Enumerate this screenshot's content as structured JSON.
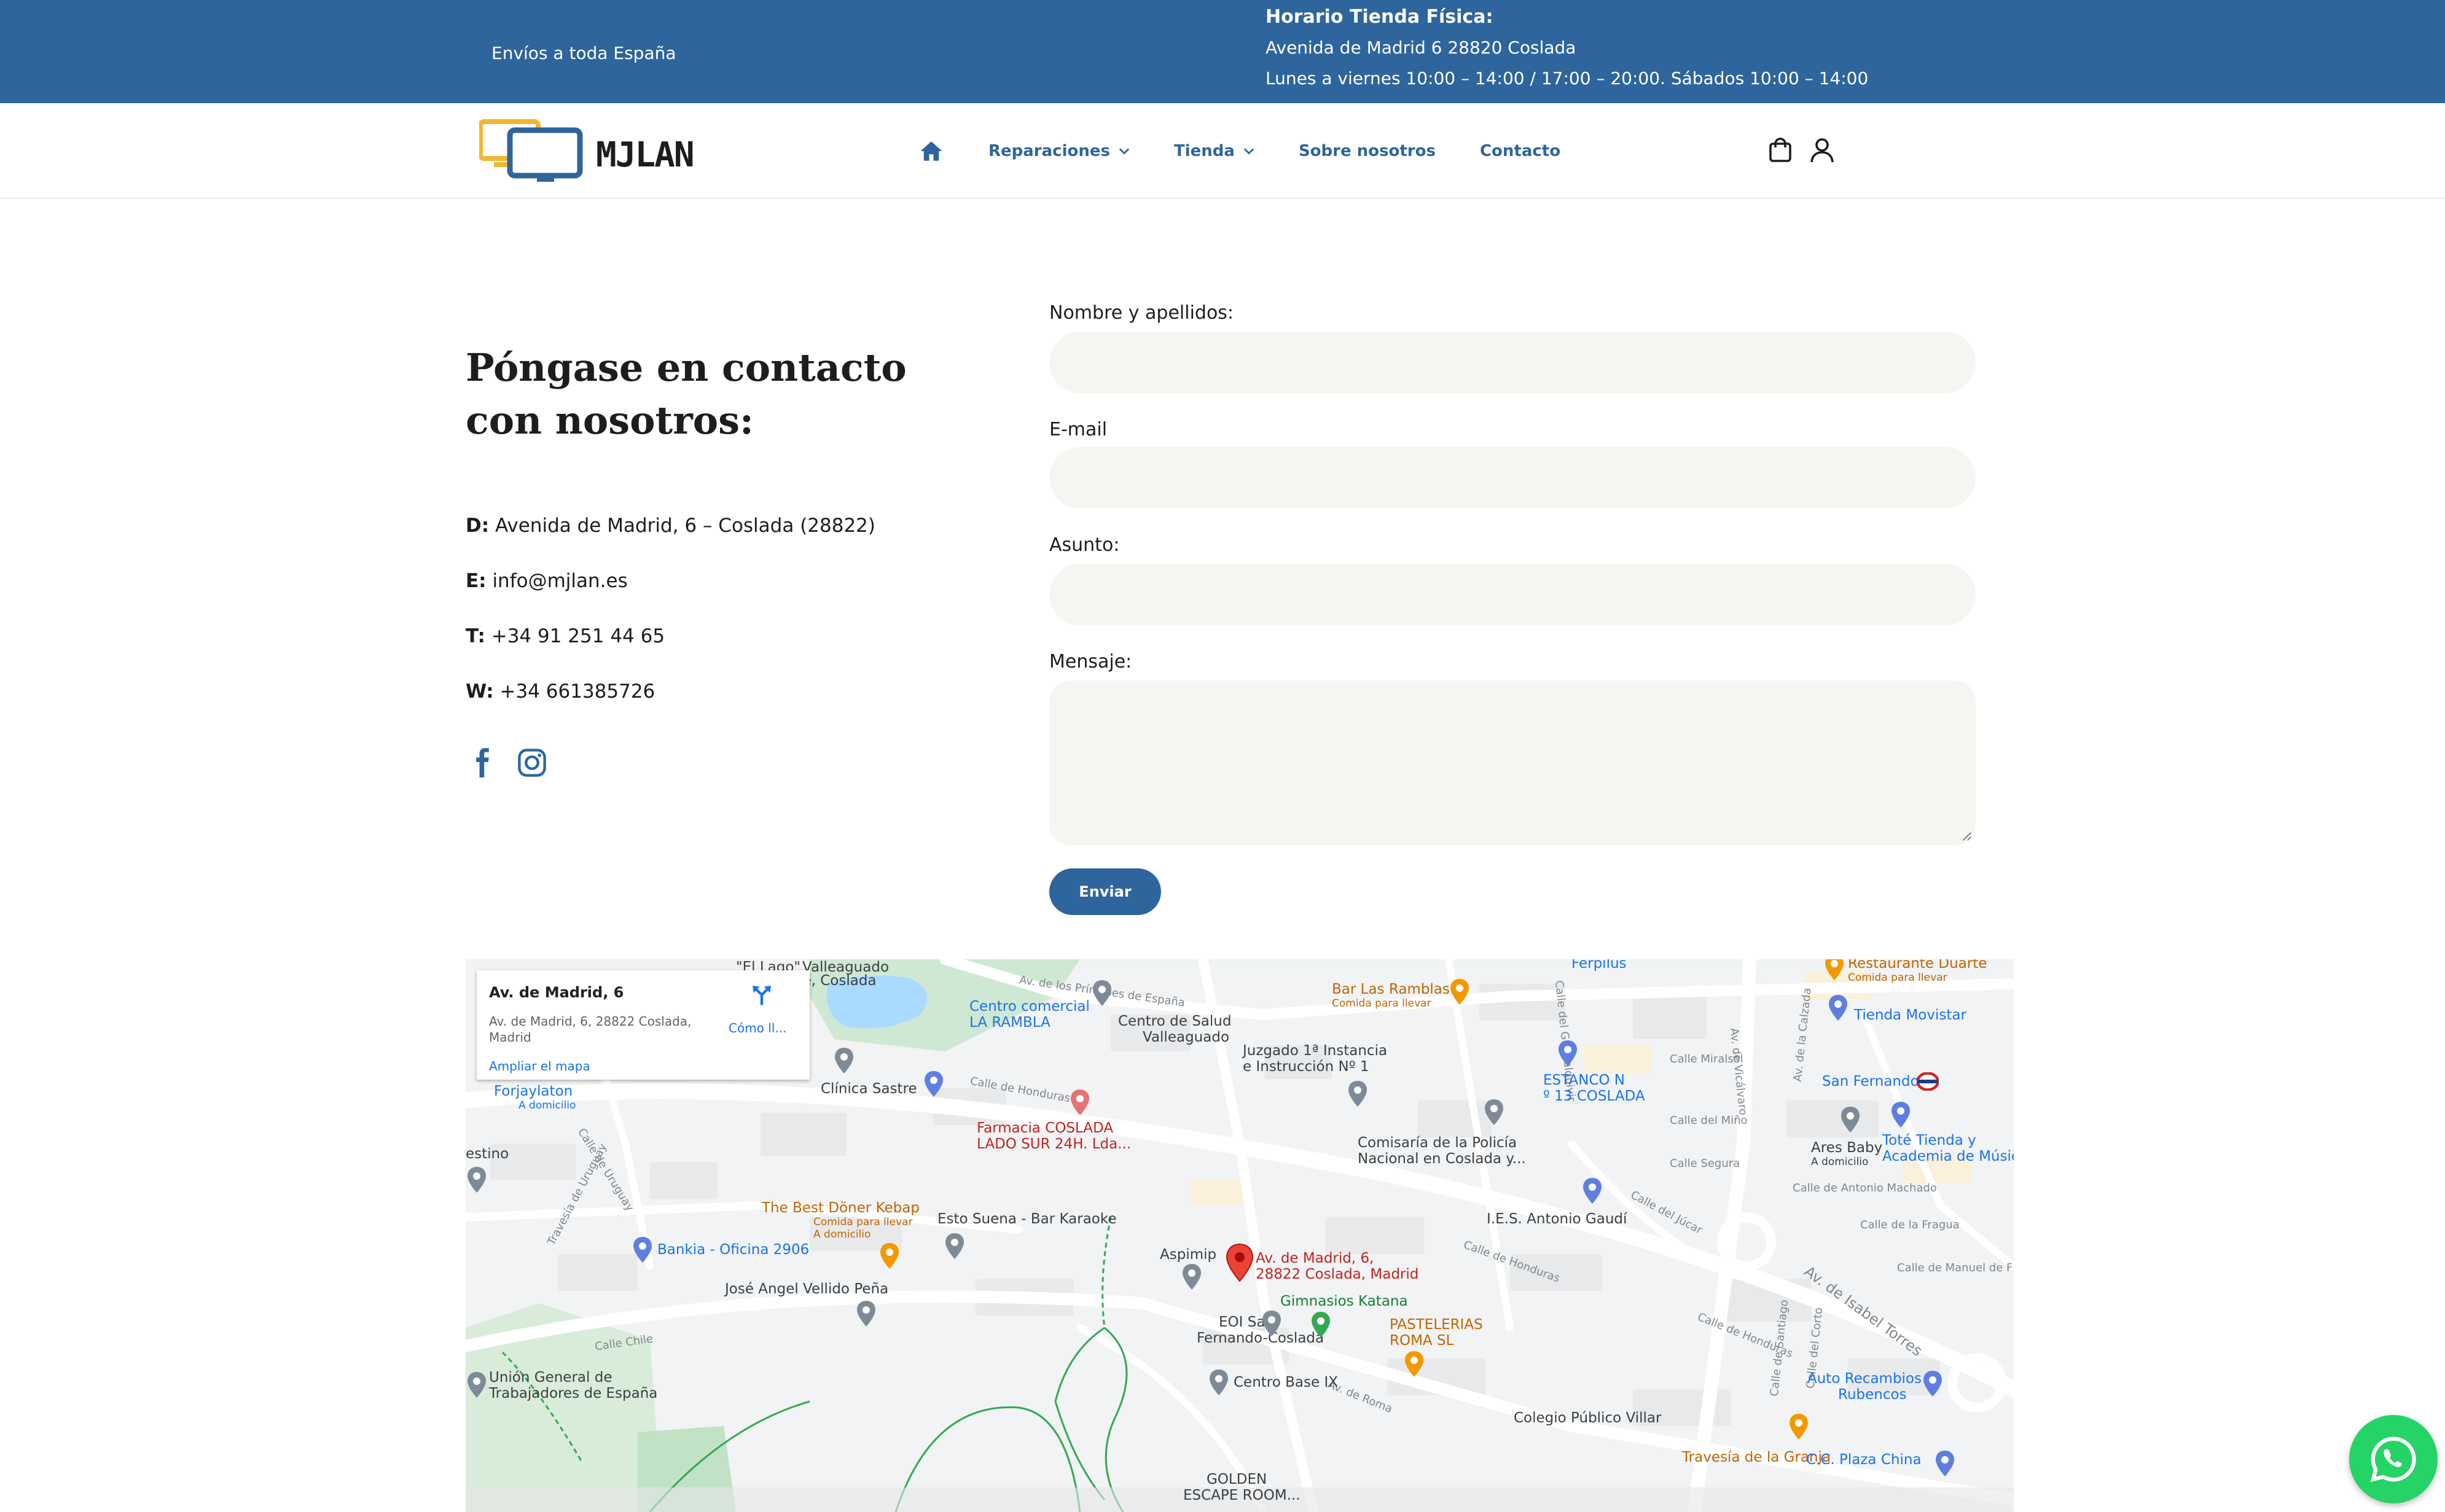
{
  "topbar": {
    "shipping": "Envíos a toda España",
    "hours_title": "Horario Tienda Física:",
    "hours_address": "Avenida de Madrid 6 28820 Coslada",
    "hours_schedule": "Lunes a viernes 10:00 – 14:00 / 17:00 – 20:00. Sábados 10:00 – 14:00"
  },
  "header": {
    "logo_text": "MJLAN",
    "nav": [
      {
        "label": "Reparaciones",
        "has_dropdown": true
      },
      {
        "label": "Tienda",
        "has_dropdown": true
      },
      {
        "label": "Sobre nosotros",
        "has_dropdown": false
      },
      {
        "label": "Contacto",
        "has_dropdown": false
      }
    ],
    "icons": [
      "home-icon",
      "cart-icon",
      "user-icon"
    ]
  },
  "contact": {
    "title": "Póngase en contacto con nosotros:",
    "items": [
      {
        "key": "D:",
        "value": "Avenida de Madrid, 6 – Coslada (28822)"
      },
      {
        "key": "E:",
        "value": "info@mjlan.es"
      },
      {
        "key": "T:",
        "value": "+34 91 251 44 65"
      },
      {
        "key": "W:",
        "value": "+34 661385726"
      }
    ],
    "social": [
      "facebook-icon",
      "instagram-icon"
    ]
  },
  "form": {
    "name_label": "Nombre y apellidos:",
    "name_value": "",
    "email_label": "E-mail",
    "email_value": "",
    "subject_label": "Asunto:",
    "subject_value": "",
    "message_label": "Mensaje:",
    "message_value": "",
    "submit_label": "Enviar"
  },
  "map": {
    "card_title": "Av. de Madrid, 6",
    "card_address": "Av. de Madrid, 6, 28822 Coslada, Madrid",
    "card_directions": "Cómo ll...",
    "card_enlarge": "Ampliar el mapa",
    "labels": {
      "el_lago": "\"El Lago\"",
      "valleaguado": "Valleaguado",
      "coslada": "rte, Coslada",
      "cc_rambla": "Centro comercial",
      "cc_rambla2": "LA RAMBLA",
      "centro_salud": "Centro de Salud",
      "centro_salud2": "Valleaguado",
      "bar_ramblas": "Bar Las Ramblas",
      "bar_ramblas_sub": "Comida para llevar",
      "restaurante": "Restaurante Duarte",
      "restaurante_sub": "Comida para llevar",
      "tienda_movistar": "Tienda Movistar",
      "juzgado": "Juzgado 1ª Instancia",
      "juzgado2": "e Instrucción Nº 1",
      "estanco": "ESTANCO N",
      "estanco2": "º 13 COSLADA",
      "san_fernando": "San Fernando",
      "forjaylaton": "Forjaylaton",
      "forjaylaton_sub": "A domicilio",
      "clinica": "Clínica Sastre",
      "farmacia": "Farmacia COSLADA",
      "farmacia2": "LADO SUR 24H. Lda...",
      "comisaria": "Comisaría de la Policía",
      "comisaria2": "Nacional en Coslada y...",
      "ares_baby": "Ares Baby",
      "ares_baby_sub": "A domicilio",
      "tote": "Toté Tienda y",
      "tote2": "Academia de Músic",
      "estino": "estino",
      "doner": "The Best Döner Kebap",
      "doner_sub": "Comida para llevar",
      "doner_sub2": "A domicilio",
      "esto_suena": "Esto Suena - Bar Karaoke",
      "ies": "I.E.S. Antonio Gaudí",
      "bankia": "Bankia - Oficina 2906",
      "aspimip": "Aspimip",
      "pin_addr": "Av. de Madrid, 6,",
      "pin_addr2": "28822 Coslada, Madrid",
      "gimnasios": "Gimnasios Katana",
      "vellido": "José Angel Vellido Peña",
      "eoi": "EOI San",
      "eoi2": "Fernando-Coslada",
      "pastelerias": "PASTELERIAS",
      "pastelerias2": "ROMA SL",
      "ugt": "Unión General de",
      "ugt2": "Trabajadores de España",
      "centro_base": "Centro Base IX",
      "auto_recambios": "Auto Recambios",
      "auto_recambios2": "Rubencos",
      "colegio": "Colegio Público Villar",
      "travesia_granja": "Travesía de la Granja",
      "cc_plaza": "C.C. Plaza China",
      "golden": "GOLDEN",
      "golden2": "ESCAPE ROOM...",
      "ferpilus": "Ferpilus",
      "street_honduras": "Calle de Honduras",
      "street_chile": "Calle Chile",
      "street_roma": "Av. de Roma",
      "street_uruguay": "Calle de Uruguay",
      "street_uruguay2": "Travesía de Uruguay",
      "street_miralsol": "Calle Miralsol",
      "street_mino": "Calle del Miño",
      "street_segura": "Calle Segura",
      "street_jucar": "Calle del Júcar",
      "street_vicalvaro": "Av. de Vicálvaro",
      "street_isabel": "Av. de Isabel Torres",
      "street_fragua": "Calle de la Fragua",
      "street_antonio": "Calle de Antonio Machado",
      "street_principes": "Av. de los Príncipes de España",
      "street_guadalquivir": "Calle del Guadalquivir",
      "street_manuel": "Calle de Manuel de F",
      "street_santiago": "Calle de Santiago",
      "street_corto": "Calle del Corto",
      "street_calzada": "Av. de la Calzada"
    }
  },
  "colors": {
    "primary": "#2e659c",
    "input_bg": "#f6f5f1",
    "whatsapp": "#25d366",
    "logo_yellow": "#f2b632"
  },
  "whatsapp_icon": "whatsapp-icon"
}
